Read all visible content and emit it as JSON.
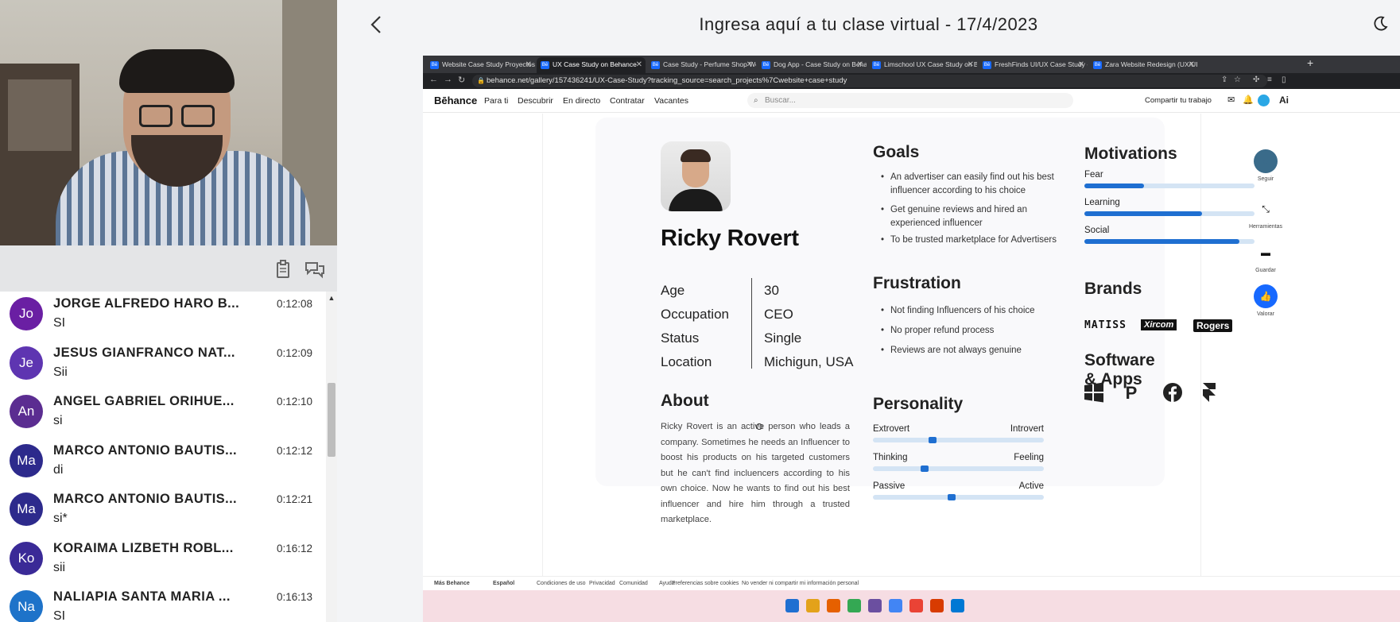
{
  "session": {
    "title": "Ingresa aquí a tu clase virtual - 17/4/2023",
    "back_icon": "chevron-left-icon",
    "theme_icon": "moon-icon"
  },
  "video": {
    "label": "webcam feed"
  },
  "chat_toolbar": {
    "icons": [
      "clipboard-icon",
      "chat-bubbles-icon"
    ]
  },
  "chat": {
    "messages": [
      {
        "initials": "Jo",
        "name": "JORGE ALFREDO HARO B...",
        "time": "0:12:08",
        "text": "SI",
        "color": "#6a1fa3"
      },
      {
        "initials": "Je",
        "name": "JESUS GIANFRANCO NAT...",
        "time": "0:12:09",
        "text": "Sii",
        "color": "#5e35b1"
      },
      {
        "initials": "An",
        "name": "ANGEL GABRIEL ORIHUE...",
        "time": "0:12:10",
        "text": "si",
        "color": "#5b2d91"
      },
      {
        "initials": "Ma",
        "name": "MARCO ANTONIO BAUTIS...",
        "time": "0:12:12",
        "text": "di",
        "color": "#2d2a8c"
      },
      {
        "initials": "Ma",
        "name": "MARCO ANTONIO BAUTIS...",
        "time": "0:12:21",
        "text": "si*",
        "color": "#2d2a8c"
      },
      {
        "initials": "Ko",
        "name": "KORAIMA LIZBETH ROBL...",
        "time": "0:16:12",
        "text": "sii",
        "color": "#3a2a97"
      },
      {
        "initials": "Na",
        "name": "NALIAPIA SANTA MARIA ...",
        "time": "0:16:13",
        "text": "SI",
        "color": "#1e73c9"
      }
    ]
  },
  "browser": {
    "tabs": [
      {
        "label": "Website Case Study Proyectos |",
        "active": false
      },
      {
        "label": "UX Case Study on Behance",
        "active": true
      },
      {
        "label": "Case Study - Perfume Shop Web",
        "active": false
      },
      {
        "label": "Dog App - Case Study on Behan",
        "active": false
      },
      {
        "label": "Limschool UX Case Study on Be",
        "active": false
      },
      {
        "label": "FreshFinds UI/UX Case Study - ",
        "active": false
      },
      {
        "label": "Zara Website Redesign (UX/UI C",
        "active": false
      }
    ],
    "url": "behance.net/gallery/157436241/UX-Case-Study?tracking_source=search_projects%7Cwebsite+case+study"
  },
  "behance": {
    "logo": "Bēhance",
    "nav": [
      "Para ti",
      "Descubrir",
      "En directo",
      "Contratar",
      "Vacantes"
    ],
    "search_placeholder": "Buscar...",
    "share_label": "Compartir tu trabajo",
    "adobe_label": "Ai"
  },
  "persona": {
    "name": "Ricky Rovert",
    "info": [
      {
        "label": "Age",
        "value": "30"
      },
      {
        "label": "Occupation",
        "value": "CEO"
      },
      {
        "label": "Status",
        "value": "Single"
      },
      {
        "label": "Location",
        "value": "Michigun, USA"
      }
    ],
    "about_title": "About",
    "about_text": "Ricky Rovert is an active person who leads a company. Sometimes he needs an Influencer to boost his products on his targeted customers but he can't find incluencers according to his own choice. Now he wants to find out his best influencer and hire him through a trusted marketplace.",
    "goals_title": "Goals",
    "goals": [
      "An advertiser can easily find out his best influencer according to his choice",
      "Get genuine reviews and hired an experienced influencer",
      "To be trusted marketplace for Advertisers"
    ],
    "frustration_title": "Frustration",
    "frustrations": [
      "Not finding Influencers of his choice",
      "No proper refund process",
      "Reviews are not always genuine"
    ],
    "personality_title": "Personality",
    "personality": [
      {
        "left": "Extrovert",
        "right": "Introvert",
        "level": 0.35
      },
      {
        "left": "Thinking",
        "right": "Feeling",
        "level": 0.3
      },
      {
        "left": "Passive",
        "right": "Active",
        "level": 0.46
      }
    ],
    "motivations_title": "Motivations",
    "motivations": [
      {
        "label": "Fear",
        "level": 0.35
      },
      {
        "label": "Learning",
        "level": 0.69
      },
      {
        "label": "Social",
        "level": 0.91
      }
    ],
    "brands_title": "Brands",
    "brands": [
      "MATISS",
      "Xircom",
      "Rogers"
    ],
    "apps_title": "Software & Apps",
    "apps": [
      "windows-icon",
      "paypal-icon",
      "facebook-icon",
      "framer-icon"
    ]
  },
  "side_actions": [
    {
      "label": "Seguir",
      "icon": "follow-avatar-icon"
    },
    {
      "label": "Herramientas",
      "icon": "tools-icon"
    },
    {
      "label": "Guardar",
      "icon": "folder-icon"
    },
    {
      "label": "Valorar",
      "icon": "thumbs-up-icon"
    }
  ],
  "footer": {
    "links": [
      "Más Behance",
      "Español",
      "Condiciones de uso",
      "Privacidad",
      "Comunidad",
      "Ayuda",
      "Preferencias sobre cookies",
      "No vender ni compartir mi información personal"
    ]
  },
  "taskbar": {
    "icons": [
      "windows-start-icon",
      "file-explorer-icon",
      "firefox-icon",
      "chrome-icon",
      "app-icon",
      "chrome-icon",
      "chrome-icon",
      "office-icon",
      "vscode-icon"
    ]
  }
}
